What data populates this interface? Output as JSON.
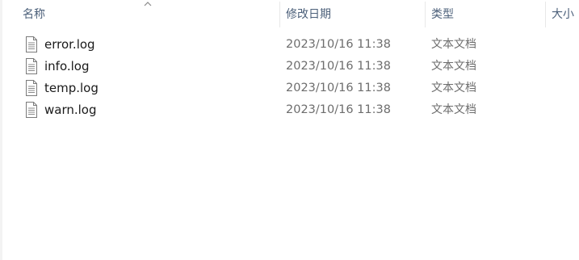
{
  "columns": {
    "name": "名称",
    "date_modified": "修改日期",
    "type": "类型",
    "size": "大小"
  },
  "sort": {
    "column": "name",
    "direction": "ascending",
    "icon": "chevron-up-icon"
  },
  "files": [
    {
      "name": "error.log",
      "date_modified": "2023/10/16 11:38",
      "type": "文本文档",
      "icon": "text-file-icon"
    },
    {
      "name": "info.log",
      "date_modified": "2023/10/16 11:38",
      "type": "文本文档",
      "icon": "text-file-icon"
    },
    {
      "name": "temp.log",
      "date_modified": "2023/10/16 11:38",
      "type": "文本文档",
      "icon": "text-file-icon"
    },
    {
      "name": "warn.log",
      "date_modified": "2023/10/16 11:38",
      "type": "文本文档",
      "icon": "text-file-icon"
    }
  ],
  "colors": {
    "header_text": "#4c607a",
    "name_text": "#1a1a1a",
    "secondary_text": "#6d6d6d",
    "separator": "#e8e8e8"
  }
}
